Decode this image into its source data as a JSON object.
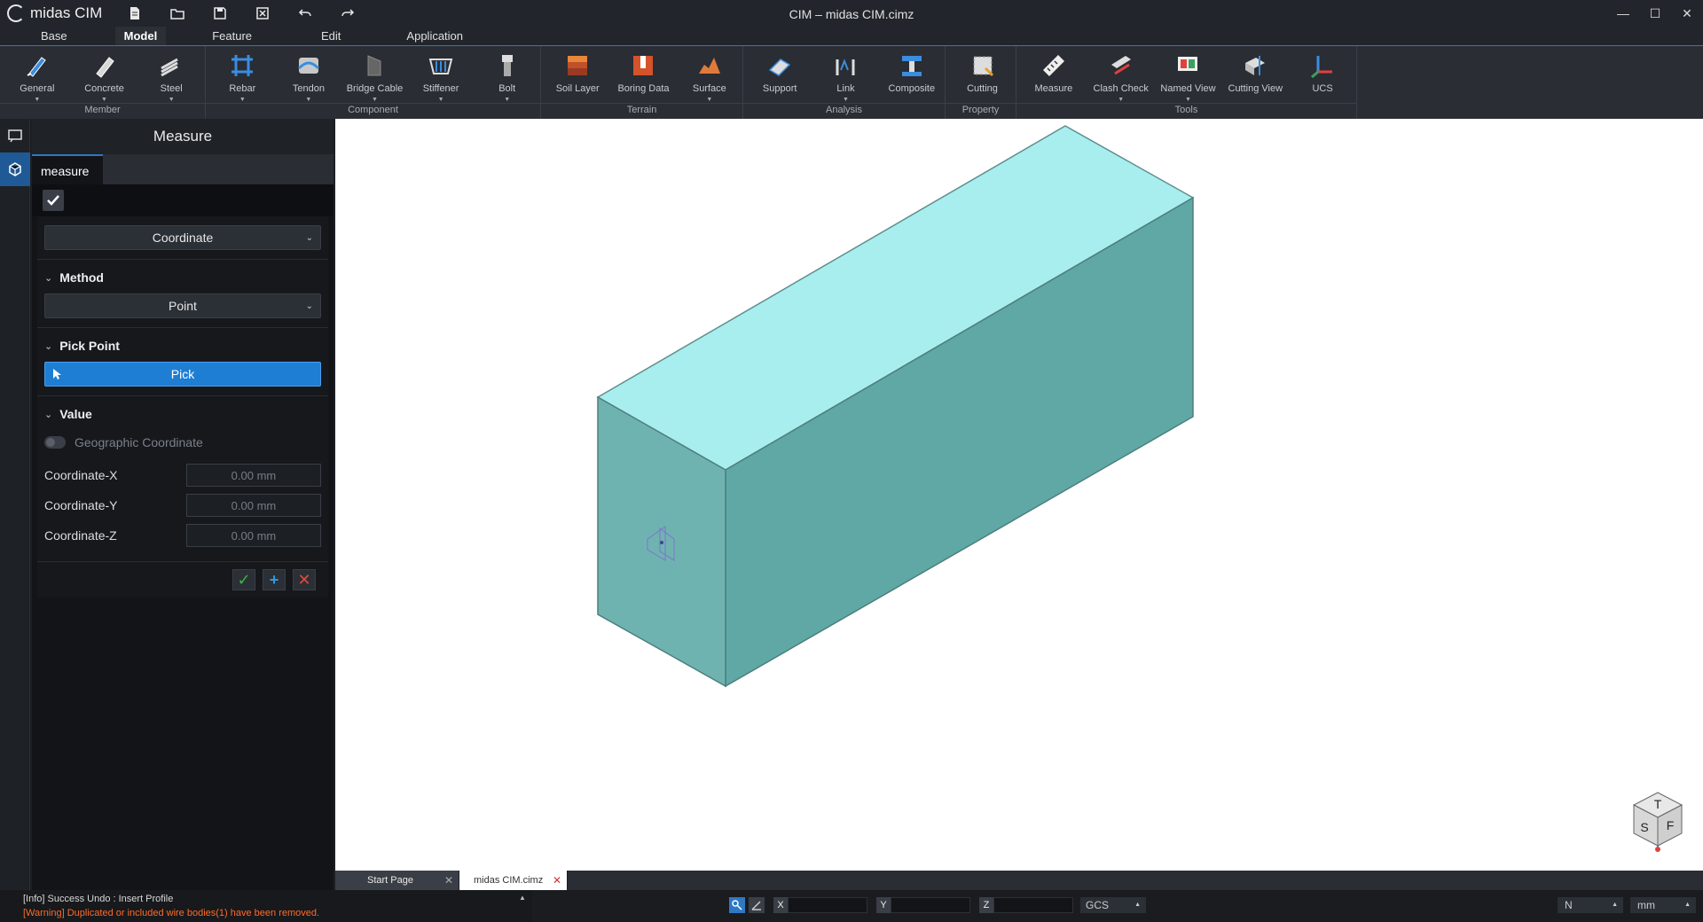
{
  "app": {
    "logo_text": "midas CIM",
    "window_title": "CIM – midas CIM.cimz"
  },
  "quick_access": [
    "new-file-icon",
    "open-folder-icon",
    "save-icon",
    "close-file-icon",
    "undo-icon",
    "redo-icon"
  ],
  "ribbon_tabs": [
    {
      "label": "Base",
      "active": false
    },
    {
      "label": "Model",
      "active": true
    },
    {
      "label": "Feature",
      "active": false
    },
    {
      "label": "Edit",
      "active": false
    },
    {
      "label": "Application",
      "active": false
    }
  ],
  "ribbon_groups": [
    {
      "label": "Member",
      "items": [
        "General",
        "Concrete",
        "Steel"
      ]
    },
    {
      "label": "Component",
      "items": [
        "Rebar",
        "Tendon",
        "Bridge Cable",
        "Stiffener",
        "Bolt"
      ]
    },
    {
      "label": "Terrain",
      "items": [
        "Soil Layer",
        "Boring Data",
        "Surface"
      ]
    },
    {
      "label": "Analysis",
      "items": [
        "Support",
        "Link",
        "Composite"
      ]
    },
    {
      "label": "Property",
      "items": [
        "Cutting"
      ]
    },
    {
      "label": "Tools",
      "items": [
        "Measure",
        "Clash Check",
        "Named View",
        "Cutting View",
        "UCS"
      ]
    }
  ],
  "panel": {
    "title": "Measure",
    "tab": "measure",
    "type_select": "Coordinate",
    "method": {
      "title": "Method",
      "value": "Point"
    },
    "pick_point": {
      "title": "Pick Point",
      "button": "Pick"
    },
    "value": {
      "title": "Value",
      "geo_toggle_label": "Geographic Coordinate",
      "fields": [
        {
          "label": "Coordinate-X",
          "value": "0.00 mm"
        },
        {
          "label": "Coordinate-Y",
          "value": "0.00 mm"
        },
        {
          "label": "Coordinate-Z",
          "value": "0.00 mm"
        }
      ]
    }
  },
  "doc_tabs": [
    {
      "label": "Start Page",
      "active": false
    },
    {
      "label": "midas CIM.cimz",
      "active": true
    }
  ],
  "navcube": {
    "top": "T",
    "side": "S",
    "front": "F"
  },
  "status": {
    "info": "[Info] Success Undo : Insert Profile",
    "warning": "[Warning] Duplicated or included wire bodies(1) have been removed.",
    "coord_labels": [
      "X",
      "Y",
      "Z"
    ],
    "cs": "GCS",
    "dir": "N",
    "unit": "mm"
  },
  "colors": {
    "accent": "#2f78c4",
    "warning": "#ff6a2a",
    "block_top": "#a9eeee",
    "block_front": "#6fb5b3",
    "block_side": "#5aa3a0"
  }
}
